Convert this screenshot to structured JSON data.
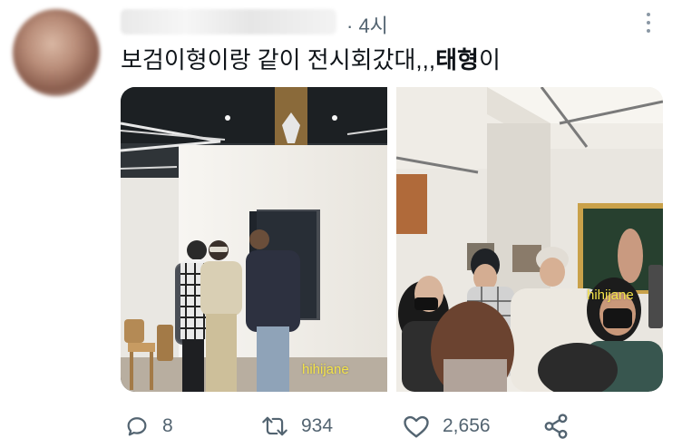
{
  "tweet": {
    "time": "· 4시",
    "text_before": "보검이형이랑 같이 전시회갔대,,,",
    "text_bold": "태형",
    "text_after": "이"
  },
  "media": {
    "watermark_left": "hihijane",
    "watermark_right": "hihijane"
  },
  "actions": {
    "reply_count": "8",
    "retweet_count": "934",
    "like_count": "2,656"
  },
  "icons": {
    "more": "more-vertical-icon",
    "reply": "reply-icon",
    "retweet": "retweet-icon",
    "like": "heart-icon",
    "share": "share-icon"
  },
  "colors": {
    "secondary_text": "#536471",
    "watermark": "#f3e34a"
  }
}
